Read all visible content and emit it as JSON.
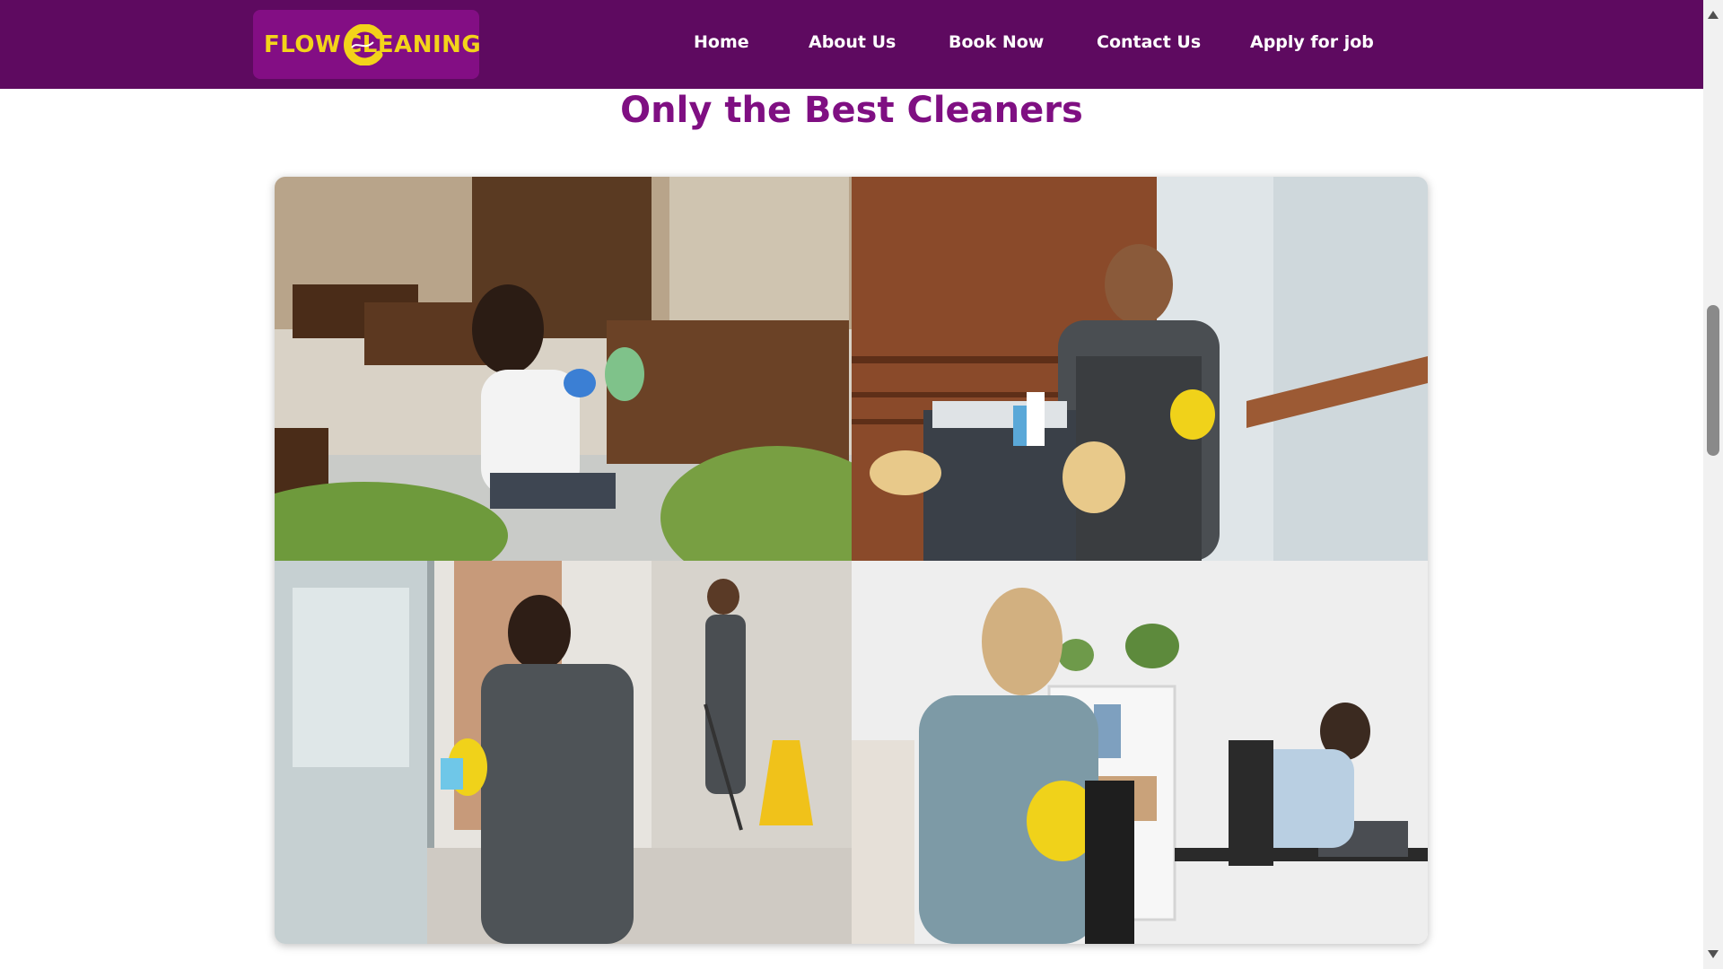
{
  "header": {
    "logo": {
      "left_text": "FLOW",
      "right_text": "CLEANING",
      "ring_icon": "swirl-c-icon"
    },
    "nav": [
      {
        "label": "Home"
      },
      {
        "label": "About Us"
      },
      {
        "label": "Book Now"
      },
      {
        "label": "Contact Us"
      },
      {
        "label": "Apply for job"
      }
    ]
  },
  "main": {
    "title": "Only the Best Cleaners"
  },
  "colors": {
    "header_bg": "#5e0a60",
    "logo_bg": "#830e84",
    "logo_text": "#f3d31a",
    "title": "#7f0f82"
  }
}
